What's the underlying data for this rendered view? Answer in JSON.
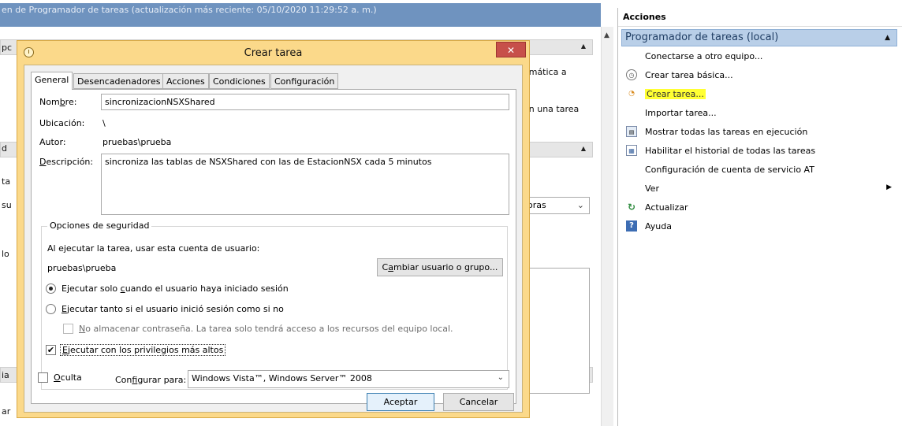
{
  "background": {
    "title_fragment": "en de Programador de tareas (actualización más reciente: 05/10/2020 11:29:52 a. m.)",
    "fragments": {
      "f1": "ómática a",
      "f2": "en una tarea",
      "f3": "oras",
      "left1": "pc",
      "left2": "d",
      "left3": "ta",
      "left4": "su",
      "left5": "lo",
      "left6": "ia",
      "left7": "ar"
    }
  },
  "actions": {
    "header": "Acciones",
    "group": "Programador de tareas (local)",
    "items": [
      {
        "label": "Conectarse a otro equipo...",
        "icon": ""
      },
      {
        "label": "Crear tarea básica...",
        "icon": "basic-task-icon"
      },
      {
        "label": "Crear tarea...",
        "icon": "create-task-icon"
      },
      {
        "label": "Importar tarea...",
        "icon": ""
      },
      {
        "label": "Mostrar todas las tareas en ejecución",
        "icon": "running-tasks-icon"
      },
      {
        "label": "Habilitar el historial de todas las tareas",
        "icon": "history-icon"
      },
      {
        "label": "Configuración de cuenta de servicio AT",
        "icon": ""
      },
      {
        "label": "Ver",
        "icon": ""
      },
      {
        "label": "Actualizar",
        "icon": "refresh-icon"
      },
      {
        "label": "Ayuda",
        "icon": "help-icon"
      }
    ]
  },
  "dialog": {
    "title": "Crear tarea",
    "close": "✕",
    "tabs": [
      "General",
      "Desencadenadores",
      "Acciones",
      "Condiciones",
      "Configuración"
    ],
    "general": {
      "name_label_a": "Nom",
      "name_label_u": "b",
      "name_label_b": "re:",
      "name_value": "sincronizacionNSXShared",
      "location_label": "Ubicación:",
      "location_value": "\\",
      "author_label": "Autor:",
      "author_value": "pruebas\\prueba",
      "desc_label_u": "D",
      "desc_label_b": "escripción:",
      "desc_value": "sincroniza las tablas de NSXShared con las de EstacionNSX cada 5 minutos"
    },
    "security": {
      "title": "Opciones de seguridad",
      "run_as_label": "Al ejecutar la tarea, usar esta cuenta de usuario:",
      "user": "pruebas\\prueba",
      "change_button_a": "C",
      "change_button_u": "a",
      "change_button_b": "mbiar usuario o grupo...",
      "radio1_a": "Ejecutar solo ",
      "radio1_u": "c",
      "radio1_b": "uando el usuario haya iniciado sesión",
      "radio2_u": "E",
      "radio2_b": "jecutar tanto si el usuario inició sesión como si no",
      "no_store_u": "N",
      "no_store_b": "o almacenar contraseña. La tarea solo tendrá acceso a los recursos del equipo local.",
      "highest_u": "E",
      "highest_b": "jecutar con los privilegios más altos"
    },
    "hidden_u": "O",
    "hidden_b": "culta",
    "configure_label_a": "Con",
    "configure_label_u": "f",
    "configure_label_b": "igurar para:",
    "configure_value": "Windows Vista™, Windows Server™ 2008",
    "ok": "Aceptar",
    "cancel": "Cancelar"
  }
}
